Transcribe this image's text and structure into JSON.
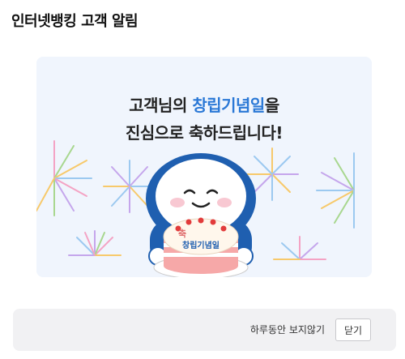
{
  "popup": {
    "title": "인터넷뱅킹 고객 알림"
  },
  "banner": {
    "line1_prefix": "고객님의 ",
    "line1_highlight": "창립기념일",
    "line1_suffix": "을",
    "line2": "진심으로 축하드립니다!",
    "cake_char": "축",
    "cake_text": "창립기념일",
    "illustration": "mascot-with-cake-and-fireworks",
    "colors": {
      "background": "#f0f5fd",
      "highlight": "#2a78d6",
      "mascot_hood": "#1f5fb0"
    }
  },
  "footer": {
    "hide_today_label": "하루동안 보지않기",
    "close_label": "닫기"
  }
}
